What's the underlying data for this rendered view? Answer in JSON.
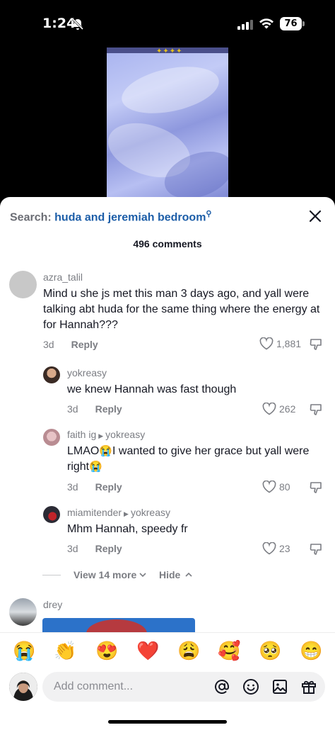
{
  "status_bar": {
    "time": "1:24",
    "battery": "76"
  },
  "sheet": {
    "search_label": "Search:",
    "search_query": "huda and jeremiah bedroom",
    "comment_count": "496 comments"
  },
  "comments": [
    {
      "user": "azra_talil",
      "text": "Mind u she js met this man 3 days ago, and yall were talking abt huda for the same thing where the energy at for Hannah???",
      "age": "3d",
      "reply": "Reply",
      "likes": "1,881"
    }
  ],
  "replies": [
    {
      "user": "yokreasy",
      "text": "we knew Hannah was fast though",
      "age": "3d",
      "reply": "Reply",
      "likes": "262"
    },
    {
      "user": "faith ig",
      "reply_to": "yokreasy",
      "text_a": "LMAO",
      "emoji_a": "😭",
      "text_b": "I wanted to give her grace but yall were right",
      "emoji_b": "😭",
      "age": "3d",
      "reply": "Reply",
      "likes": "80"
    },
    {
      "user": "miamitender",
      "reply_to": "yokreasy",
      "text": "Mhm Hannah, speedy fr",
      "age": "3d",
      "reply": "Reply",
      "likes": "23"
    }
  ],
  "thread_controls": {
    "view_more": "View 14 more",
    "hide": "Hide"
  },
  "next_comment": {
    "user": "drey"
  },
  "emoji_bar": [
    "😭",
    "👏",
    "😍",
    "❤️",
    "😩",
    "🥰",
    "🥺",
    "😁"
  ],
  "composer": {
    "placeholder": "Add comment..."
  },
  "colors": {
    "link_blue": "#1d5ea8",
    "muted_gray": "#7b7d83",
    "text": "#161823"
  }
}
